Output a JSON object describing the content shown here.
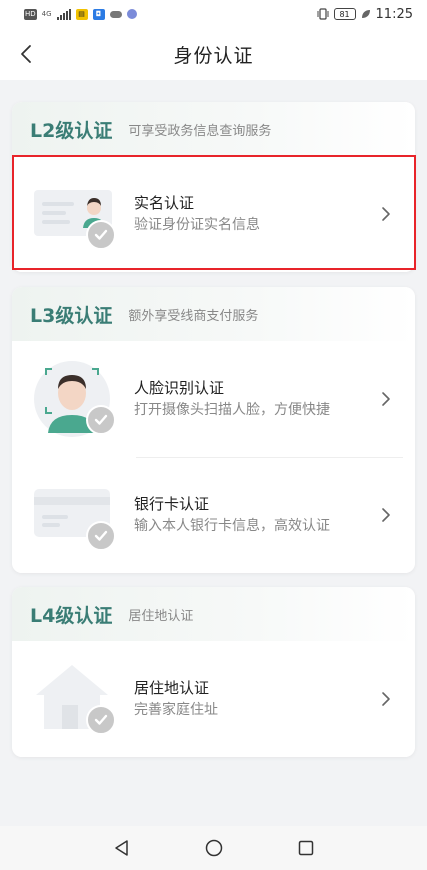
{
  "status_bar": {
    "hd": "HD",
    "net": "4G",
    "time": "11:25",
    "battery": "81"
  },
  "header": {
    "title": "身份认证"
  },
  "sections": [
    {
      "level": "L2级认证",
      "desc": "可享受政务信息查询服务",
      "items": [
        {
          "title": "实名认证",
          "subtitle": "验证身份证实名信息",
          "icon": "id-card-illustration"
        }
      ]
    },
    {
      "level": "L3级认证",
      "desc": "额外享受线商支付服务",
      "items": [
        {
          "title": "人脸识别认证",
          "subtitle": "打开摄像头扫描人脸，方便快捷",
          "icon": "face-scan-illustration"
        },
        {
          "title": "银行卡认证",
          "subtitle": "输入本人银行卡信息，高效认证",
          "icon": "bank-card-illustration"
        }
      ]
    },
    {
      "level": "L4级认证",
      "desc": "居住地认证",
      "items": [
        {
          "title": "居住地认证",
          "subtitle": "完善家庭住址",
          "icon": "house-illustration"
        }
      ]
    }
  ],
  "colors": {
    "accent": "#3a7d75",
    "highlight": "#e8242a",
    "background": "#f2f3f5"
  }
}
